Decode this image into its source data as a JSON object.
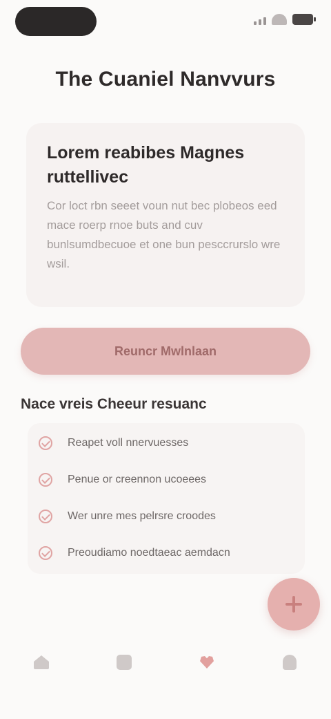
{
  "page": {
    "title": "The Cuaniel Nanvvurs"
  },
  "card": {
    "heading": "Lorem reabibes Magnes ruttellivec",
    "body": "Cor loct rbn seeet voun nut bec plobeos eed mace roerp rnoe buts and cuv bunlsumdbecuoe et one bun pesccrurslo wre wsil."
  },
  "primary_button": {
    "label": "Reuncr Mwlnlaan"
  },
  "checklist": {
    "heading": "Nace vreis Cheeur resuanc",
    "items": [
      {
        "label": "Reapet voll nnervuesses"
      },
      {
        "label": "Penue or creennon ucoeees"
      },
      {
        "label": "Wer unre mes pelrsre croodes"
      },
      {
        "label": "Preoudiamo noedtaeac aemdacn"
      }
    ]
  },
  "fab": {
    "icon": "plus-icon"
  },
  "bottom_nav": {
    "items": [
      {
        "label": "",
        "icon": "home-icon"
      },
      {
        "label": "",
        "icon": "grid-icon"
      },
      {
        "label": "",
        "icon": "heart-icon",
        "active": true
      },
      {
        "label": "",
        "icon": "user-icon"
      }
    ]
  },
  "colors": {
    "accent": "#e3b7b6",
    "accent_dark": "#c9807e",
    "background": "#fbfaf9",
    "card": "#f6f2f1",
    "text": "#2e2a2a",
    "muted_text": "#a39c9b"
  }
}
